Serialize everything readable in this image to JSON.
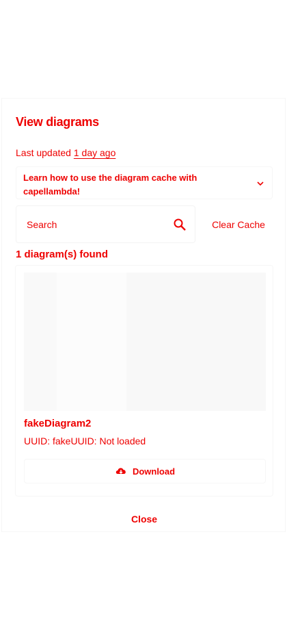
{
  "modal": {
    "title": "View diagrams",
    "last_updated_prefix": "Last updated ",
    "last_updated_ago": "1 day ago",
    "learn_more": "Learn how to use the diagram cache with capellambda!",
    "search_placeholder": "Search",
    "clear_cache_label": "Clear Cache",
    "count_text": "1 diagram(s) found",
    "close_label": "Close"
  },
  "diagram": {
    "name": "fakeDiagram2",
    "uuid_text": "UUID: fakeUUID: Not loaded",
    "download_label": "Download"
  },
  "icons": {
    "learn_more": "chevron-down-icon",
    "search": "search-icon",
    "download": "download-icon"
  },
  "colors": {
    "text": "#ee0000"
  }
}
